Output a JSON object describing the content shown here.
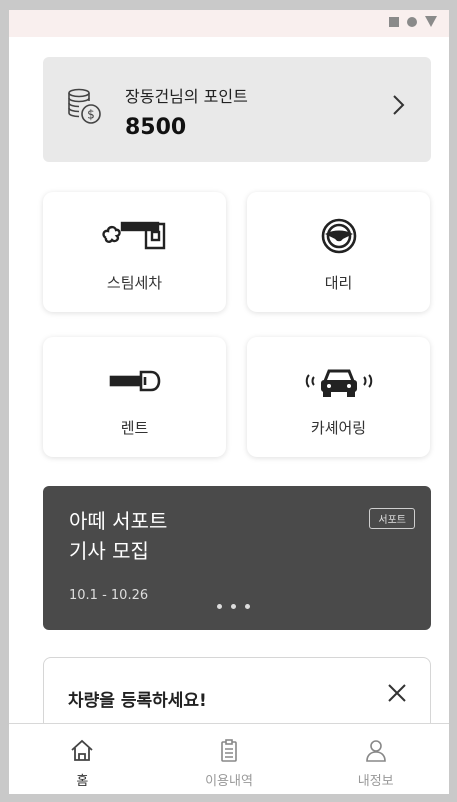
{
  "status_bar": {
    "icons": [
      "square-icon",
      "circle-icon",
      "triangle-icon"
    ]
  },
  "points": {
    "label": "장동건님의 포인트",
    "value": "8500",
    "icon": "coin-stack-icon",
    "chevron": "chevron-right-icon"
  },
  "services": [
    {
      "label": "스팀세차",
      "icon": "steam-wash-icon"
    },
    {
      "label": "대리",
      "icon": "steering-wheel-icon"
    },
    {
      "label": "렌트",
      "icon": "key-icon"
    },
    {
      "label": "카셰어링",
      "icon": "car-signal-icon"
    }
  ],
  "banner": {
    "title_line1": "아떼 서포트",
    "title_line2": "기사 모집",
    "dates": "10.1 - 10.26",
    "badge": "서포트",
    "page_count": 3
  },
  "register_card": {
    "text": "차량을 등록하세요!",
    "close_icon": "close-icon"
  },
  "tab_bar": {
    "tabs": [
      {
        "label": "홈",
        "icon": "home-icon",
        "active": true
      },
      {
        "label": "이용내역",
        "icon": "clipboard-icon",
        "active": false
      },
      {
        "label": "내정보",
        "icon": "user-icon",
        "active": false
      }
    ]
  }
}
